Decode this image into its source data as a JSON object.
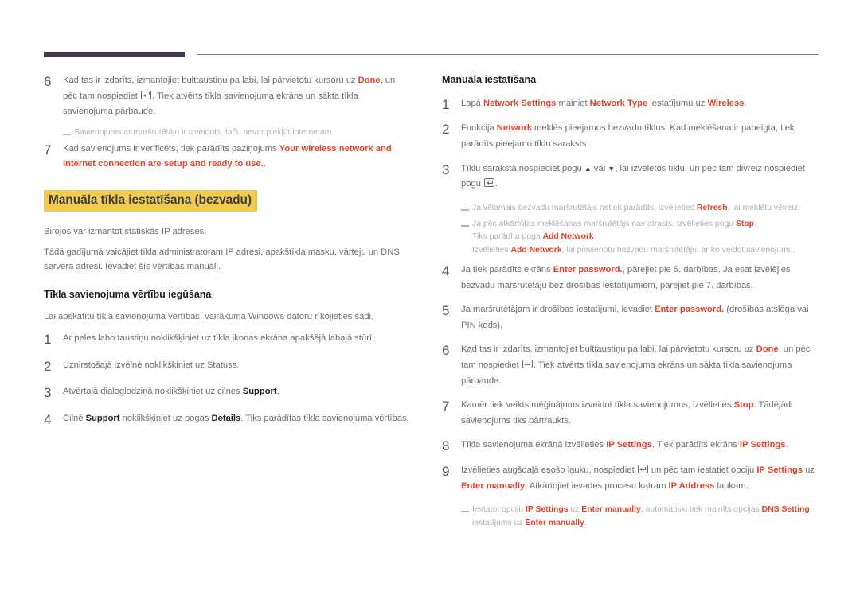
{
  "header": {
    "bar_color": "#443a52",
    "rule_color": "#7d7d7d"
  },
  "colors": {
    "accent": "#e4432a",
    "highlight": "#f0cb52",
    "body_text": "#6d6e70",
    "note_text": "#b1b1b3",
    "heading_text": "#231f20"
  },
  "left_column": {
    "step6": {
      "number": "6",
      "text_a": "Kad tas ir izdarīts, izmantojiet bulttaustiņu pa labi, lai pārvietotu kursoru uz ",
      "accent_a": "Done",
      "text_b": ", un pēc tam nospiediet ",
      "text_c": ". Tiek atvērts tīkla savienojuma ekrāns un sākta tīkla savienojuma pārbaude."
    },
    "note6": {
      "text": "Savienojums ar maršrutētāju ir izveidots, taču nevar piekļūt internetam."
    },
    "step7": {
      "number": "7",
      "text_a": "Kad savienojums ir verificēts, tiek parādīts paziņojums ",
      "accent_a": "Your wireless network and Internet connection are setup and ready to use.",
      "text_b": "."
    },
    "heading_manual": "Manuāla tīkla iestatīšana (bezvadu)",
    "para1": "Birojos var izmantot statiskās IP adreses.",
    "para2": "Tādā gadījumā vaicājiet tīkla administratoram IP adresi, apakštīkla masku, vārteju un DNS servera adresi. Ievadiet šīs vērtības manuāli.",
    "heading_values": "Tīkla savienojuma vērtību iegūšana",
    "para3": "Lai apskatītu tīkla savienojuma vērtības, vairākumā Windows datoru rīkojieties šādi.",
    "step1": {
      "number": "1",
      "text_a": "Ar peles labo taustiņu noklikšķiniet uz tīkla ikonas ekrāna apakšējā labajā stūrī."
    },
    "step2": {
      "number": "2",
      "text_a": "Uznirstošajā izvēlnē noklikšķiniet uz Statuss."
    },
    "step3": {
      "number": "3",
      "text_a": "Atvērtajā dialoglodziņā noklikšķiniet uz cilnes ",
      "bold_a": "Support",
      "text_b": "."
    },
    "step4": {
      "number": "4",
      "text_a": "Cilnē ",
      "bold_a": "Support",
      "text_b": " noklikšķiniet uz pogas ",
      "bold_b": "Details",
      "text_c": ". Tiks parādītas tīkla savienojuma vērtības."
    }
  },
  "right_column": {
    "heading_manual_setup": "Manuālā iestatīšana",
    "step1": {
      "number": "1",
      "text_a": "Lapā ",
      "accent_a": "Network Settings",
      "text_b": " mainiet ",
      "accent_b": "Network Type",
      "text_c": " iestatījumu uz ",
      "accent_c": "Wireless",
      "text_d": "."
    },
    "step2": {
      "number": "2",
      "text_a": "Funkcija ",
      "accent_a": "Network",
      "text_b": " meklēs pieejamos bezvadu tīklus. Kad meklēšana ir pabeigta, tiek parādīts pieejamo tīklu saraksts."
    },
    "step3": {
      "number": "3",
      "text_a": "Tīklu sarakstā nospiediet pogu ",
      "text_b": " vai ",
      "text_c": ", lai izvēlētos tīklu, un pēc tam divreiz nospiediet pogu ",
      "text_d": "."
    },
    "note_refresh": {
      "text_a": "Ja vēlamais bezvadu maršrutētājs netiek parādīts, izvēlieties ",
      "accent_a": "Refresh",
      "text_b": ", lai meklētu vēlreiz."
    },
    "note_stop": {
      "text_a": "Ja pēc atkārtotas meklēšanas maršrutētājs nav atrasts, izvēlieties pogu ",
      "accent_a": "Stop",
      "text_b": "."
    },
    "note_stop_line2": {
      "text_a": "Tiks parādīta poga ",
      "accent_a": "Add Network",
      "text_b": "."
    },
    "note_stop_line3": {
      "text_a": "Izvēlieties ",
      "accent_a": "Add Network",
      "text_b": ", lai pievienotu bezvadu maršrutētāju, ar ko veidot savienojumu."
    },
    "step4": {
      "number": "4",
      "text_a": "Ja tiek parādīts ekrāns ",
      "accent_a": "Enter password.",
      "text_b": ", pārejiet pie 5. darbības. Ja esat izvēlējies bezvadu maršrutētāju bez drošības iestatījumiem, pārejiet pie 7. darbības."
    },
    "step5": {
      "number": "5",
      "text_a": "Ja maršrutētājam ir drošības iestatījumi, ievadiet ",
      "accent_a": "Enter password.",
      "text_b": " (drošības atslēga vai PIN kods)."
    },
    "step6": {
      "number": "6",
      "text_a": "Kad tas ir izdarīts, izmantojiet bulttaustiņu pa labi, lai pārvietotu kursoru uz ",
      "accent_a": "Done",
      "text_b": ", un pēc tam nospiediet ",
      "text_c": ". Tiek atvērts tīkla savienojuma ekrāns un sākta tīkla savienojuma pārbaude."
    },
    "step7": {
      "number": "7",
      "text_a": "Kamēr tiek veikts mēģinājums izveidot tīkla savienojumus, izvēlieties ",
      "accent_a": "Stop",
      "text_b": ". Tādējādi savienojums tiks pārtraukts."
    },
    "step8": {
      "number": "8",
      "text_a": "Tīkla savienojuma ekrānā izvēlieties ",
      "accent_a": "IP Settings",
      "text_b": ". Tiek parādīts ekrāns ",
      "accent_b": "IP Settings",
      "text_c": "."
    },
    "step9": {
      "number": "9",
      "text_a": "Izvēlieties augšdaļā esošo lauku, nospiediet ",
      "text_b": " un pēc tam iestatiet opciju ",
      "accent_a": "IP Settings",
      "text_c": " uz ",
      "accent_b": "Enter manually",
      "text_d": ". Atkārtojiet ievades procesu katram ",
      "accent_c": "IP Address",
      "text_e": " laukam."
    },
    "note9": {
      "text_a": "Iestatot opciju ",
      "accent_a": "IP Settings",
      "text_b": " uz ",
      "accent_b": "Enter manually",
      "text_c": ", automātiski tiek mainīts opcijas ",
      "accent_c": "DNS Setting",
      "text_d": " iestatījums uz ",
      "accent_d": "Enter manually",
      "text_e": "."
    }
  },
  "icons": {
    "enter_key": "enter-key-icon",
    "arrow_up": "▲",
    "arrow_down": "▼"
  }
}
